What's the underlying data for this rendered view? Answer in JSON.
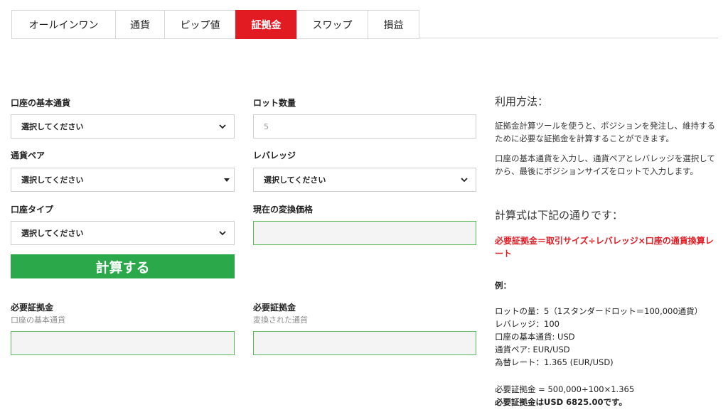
{
  "tabs": [
    {
      "label": "オールインワン",
      "active": false
    },
    {
      "label": "通貨",
      "active": false
    },
    {
      "label": "ピップ値",
      "active": false
    },
    {
      "label": "証拠金",
      "active": true
    },
    {
      "label": "スワップ",
      "active": false
    },
    {
      "label": "損益",
      "active": false
    }
  ],
  "form": {
    "base_currency": {
      "label": "口座の基本通貨",
      "value": "選択してください"
    },
    "lot_size": {
      "label": "ロット数量",
      "placeholder": "5"
    },
    "currency_pair": {
      "label": "通貨ペア",
      "value": "選択してください"
    },
    "leverage": {
      "label": "レバレッジ",
      "value": "選択してください"
    },
    "account_type": {
      "label": "口座タイプ",
      "value": "選択してください"
    },
    "conversion_price": {
      "label": "現在の変換価格"
    },
    "calculate_label": "計算する",
    "required_margin_base": {
      "label": "必要証拠金",
      "sublabel": "口座の基本通貨"
    },
    "required_margin_converted": {
      "label": "必要証拠金",
      "sublabel": "変換された通貨"
    }
  },
  "usage": {
    "heading": "利用方法：",
    "para1": "証拠金計算ツールを使うと、ポジションを発注し、維持するために必要な証拠金を計算することができます。",
    "para2": "口座の基本通貨を入力し、通貨ペアとレバレッジを選択してから、最後にポジションサイズをロットで入力します。",
    "formula_heading": "計算式は下記の通りです：",
    "formula": "必要証拠金＝取引サイズ÷レバレッジ×口座の通貨換算レート",
    "example_label": "例：",
    "example_lines": [
      "ロットの量：5（1スタンダードロット＝100,000通貨）",
      "レバレッジ：100",
      "口座の基本通貨: USD",
      "通貨ペア: EUR/USD",
      "為替レート：1.365 (EUR/USD)"
    ],
    "calc_line": "必要証拠金 = 500,000÷100×1.365",
    "result_line": "必要証拠金はUSD 6825.00です。"
  },
  "colors": {
    "accent": "#e21b23",
    "button": "#2aa84a",
    "output_border": "#5cb85c"
  }
}
